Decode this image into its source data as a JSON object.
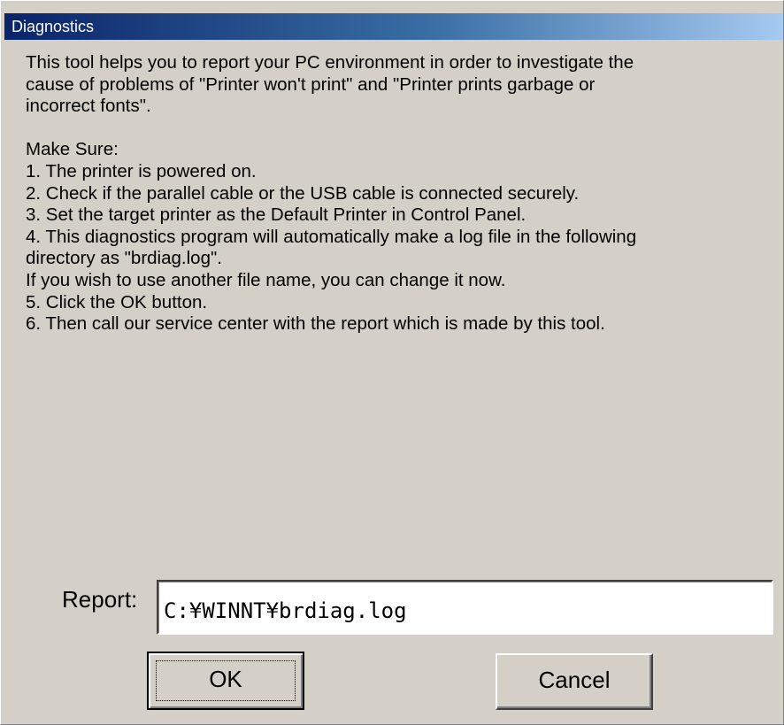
{
  "dialog": {
    "title": "Diagnostics",
    "intro": [
      "This tool helps you to report your PC environment in order to investigate the",
      "cause of  problems of \"Printer won't print\" and \"Printer prints garbage or",
      "incorrect fonts\"."
    ],
    "make_sure_label": "Make Sure:",
    "steps": [
      "1. The printer is powered on.",
      "2. Check if the parallel cable or the USB cable is connected securely.",
      "3. Set the target printer as the Default Printer in Control Panel.",
      "4. This diagnostics program will automatically make a log file in the following",
      "directory as \"brdiag.log\".",
      "If you wish to use another file name, you can change it now.",
      "5. Click the OK button.",
      "6. Then call our service center with the report which is made by this tool."
    ],
    "report_label": "Report:",
    "report_value": "C:¥WINNT¥brdiag.log",
    "ok_label": "OK",
    "cancel_label": "Cancel"
  },
  "colors": {
    "dialog_background": "#d4d0c8",
    "titlebar_start": "#0a246a",
    "titlebar_end": "#a6caf0",
    "title_text": "#ffffff"
  }
}
